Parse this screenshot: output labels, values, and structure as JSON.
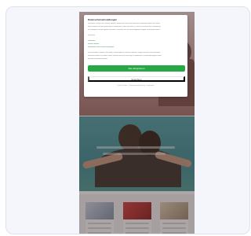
{
  "dialog": {
    "title": "Datenschutzeinstellungen",
    "paragraph": [
      "Wir nutzen Cookies auf unserer Website. Einige von ihnen sind essenziell, waehrend andere uns helfen,",
      "diese Website und Ihre Erfahrung zu verbessern. Wenn Sie unter 16 Jahre alt sind und Ihre Zustimmung",
      "zu freiwilligen Diensten geben moechten, muessen Sie Ihre Erziehungsberechtigten um Erlaubnis bitten."
    ],
    "section_label": "Essenziell",
    "links": [
      "Statistiken",
      "Externe Medien",
      "Individuelle Datenschutzeinstellungen"
    ],
    "more_text": [
      "Wir verwenden Cookies und andere Technologien auf unserer Website. Einige von ihnen sind essenziell,",
      "waehrend andere uns helfen, diese Website und Ihre Erfahrung zu verbessern. Personenbezogene Daten",
      "koennen verarbeitet werden."
    ],
    "accept_all_label": "Alle akzeptieren",
    "save_label": "Speichern",
    "footer_text": "Cookie-Details · Datenschutzerklaerung · Impressum"
  },
  "colors": {
    "accent": "#28a745",
    "overlay": "#3c2d2d"
  }
}
